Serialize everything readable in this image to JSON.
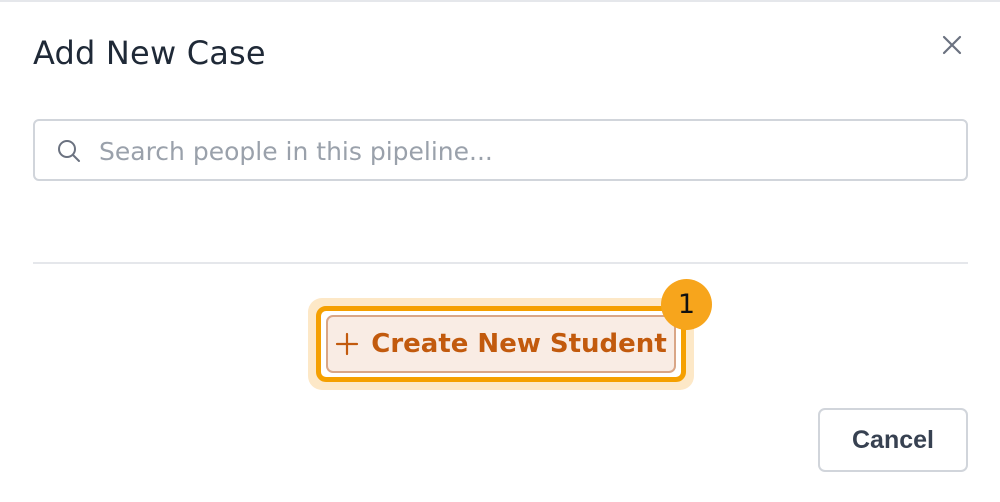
{
  "dialog": {
    "title": "Add New Case",
    "close_icon": "close-icon"
  },
  "search": {
    "value": "",
    "placeholder": "Search people in this pipeline...",
    "icon": "search-icon"
  },
  "actions": {
    "create_label": "Create New Student",
    "create_icon": "plus-icon",
    "badge_number": "1",
    "cancel_label": "Cancel"
  },
  "colors": {
    "highlight_ring": "#f5a000",
    "badge": "#f7a51c",
    "create_text": "#c25a0d",
    "create_background": "#f9ece4"
  }
}
